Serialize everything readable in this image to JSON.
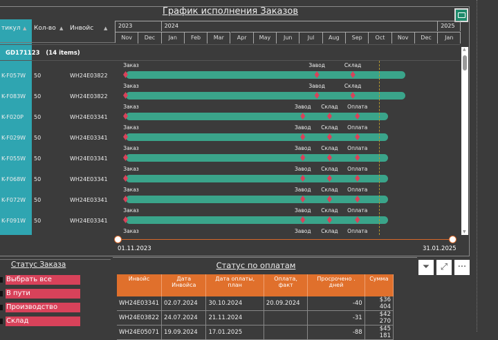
{
  "title": "График исполнения Заказов",
  "columns": {
    "article": "тикул",
    "qty": "Кол-во",
    "invoice": "Инвойс"
  },
  "timeline": {
    "years": [
      {
        "label": "2023",
        "months": 2
      },
      {
        "label": "2024",
        "months": 12
      },
      {
        "label": "2025",
        "months": 1
      }
    ],
    "months": [
      "Nov",
      "Dec",
      "Jan",
      "Feb",
      "Mar",
      "Apr",
      "May",
      "Jun",
      "Jul",
      "Aug",
      "Sep",
      "Oct",
      "Nov",
      "Dec",
      "Jan"
    ],
    "start": "2023-11-01",
    "today": "2024-10-16"
  },
  "group": {
    "name": "GD171123",
    "count": "(14 items)"
  },
  "rows": [
    {
      "article": "K-F057W",
      "qty": "50",
      "invoice": "WH24E03822",
      "start": "2023-11-15",
      "end": "2024-11-19",
      "milestones": [
        {
          "label": "Заказ",
          "date": "2023-11-15"
        },
        {
          "label": "Завод",
          "date": "2024-07-25"
        },
        {
          "label": "Склад",
          "date": "2024-09-11"
        }
      ]
    },
    {
      "article": "K-F083W",
      "qty": "50",
      "invoice": "WH24E03822",
      "start": "2023-11-15",
      "end": "2024-11-19",
      "milestones": [
        {
          "label": "Заказ",
          "date": "2023-11-15"
        },
        {
          "label": "Завод",
          "date": "2024-07-25"
        },
        {
          "label": "Склад",
          "date": "2024-09-11"
        }
      ]
    },
    {
      "article": "K-F020P",
      "qty": "50",
      "invoice": "WH24E03341",
      "start": "2023-11-15",
      "end": "2024-10-28",
      "milestones": [
        {
          "label": "Заказ",
          "date": "2023-11-15"
        },
        {
          "label": "Завод",
          "date": "2024-07-06"
        },
        {
          "label": "Склад",
          "date": "2024-08-11"
        },
        {
          "label": "Оплата",
          "date": "2024-09-17"
        }
      ]
    },
    {
      "article": "K-F029W",
      "qty": "50",
      "invoice": "WH24E03341",
      "start": "2023-11-15",
      "end": "2024-10-28",
      "milestones": [
        {
          "label": "Заказ",
          "date": "2023-11-15"
        },
        {
          "label": "Завод",
          "date": "2024-07-06"
        },
        {
          "label": "Склад",
          "date": "2024-08-11"
        },
        {
          "label": "Оплата",
          "date": "2024-09-17"
        }
      ]
    },
    {
      "article": "K-F055W",
      "qty": "50",
      "invoice": "WH24E03341",
      "start": "2023-11-15",
      "end": "2024-10-28",
      "milestones": [
        {
          "label": "Заказ",
          "date": "2023-11-15"
        },
        {
          "label": "Завод",
          "date": "2024-07-06"
        },
        {
          "label": "Склад",
          "date": "2024-08-11"
        },
        {
          "label": "Оплата",
          "date": "2024-09-17"
        }
      ]
    },
    {
      "article": "K-F068W",
      "qty": "50",
      "invoice": "WH24E03341",
      "start": "2023-11-15",
      "end": "2024-10-28",
      "milestones": [
        {
          "label": "Заказ",
          "date": "2023-11-15"
        },
        {
          "label": "Завод",
          "date": "2024-07-06"
        },
        {
          "label": "Склад",
          "date": "2024-08-11"
        },
        {
          "label": "Оплата",
          "date": "2024-09-17"
        }
      ]
    },
    {
      "article": "K-F072W",
      "qty": "50",
      "invoice": "WH24E03341",
      "start": "2023-11-15",
      "end": "2024-10-28",
      "milestones": [
        {
          "label": "Заказ",
          "date": "2023-11-15"
        },
        {
          "label": "Завод",
          "date": "2024-07-06"
        },
        {
          "label": "Склад",
          "date": "2024-08-11"
        },
        {
          "label": "Оплата",
          "date": "2024-09-17"
        }
      ]
    },
    {
      "article": "K-F091W",
      "qty": "50",
      "invoice": "WH24E03341",
      "start": "2023-11-15",
      "end": "2024-10-28",
      "milestones": [
        {
          "label": "Заказ",
          "date": "2023-11-15"
        },
        {
          "label": "Завод",
          "date": "2024-07-06"
        },
        {
          "label": "Склад",
          "date": "2024-08-11"
        },
        {
          "label": "Оплата",
          "date": "2024-09-17"
        }
      ]
    }
  ],
  "next_row_labels": [
    "Заказ",
    "Завод",
    "Склад",
    "Оплата"
  ],
  "range": {
    "from": "01.11.2023",
    "to": "31.01.2025"
  },
  "status_filter": {
    "title": "Статус Заказа",
    "items": [
      "Выбрать все",
      "В пути",
      "Производство",
      "Склад"
    ]
  },
  "payments": {
    "title": "Статус по оплатам",
    "headers": [
      "Инвойс",
      "Дата Инвойса",
      "Дата оплаты, план",
      "Оплата, факт",
      "Просрочено . дней",
      "Сумма"
    ],
    "rows": [
      [
        "WH24E03341",
        "02.07.2024",
        "30.10.2024",
        "20.09.2024",
        "-40",
        "$36 404"
      ],
      [
        "WH24E03822",
        "24.07.2024",
        "21.11.2024",
        "",
        "-31",
        "$42 270"
      ],
      [
        "WH24E05071",
        "19.09.2024",
        "17.01.2025",
        "",
        "-88",
        "$45 181"
      ]
    ]
  },
  "colors": {
    "accent": "#2fa5b1",
    "bar": "#3aa48a",
    "milestone": "#d8425a",
    "header": "#e0702c"
  }
}
